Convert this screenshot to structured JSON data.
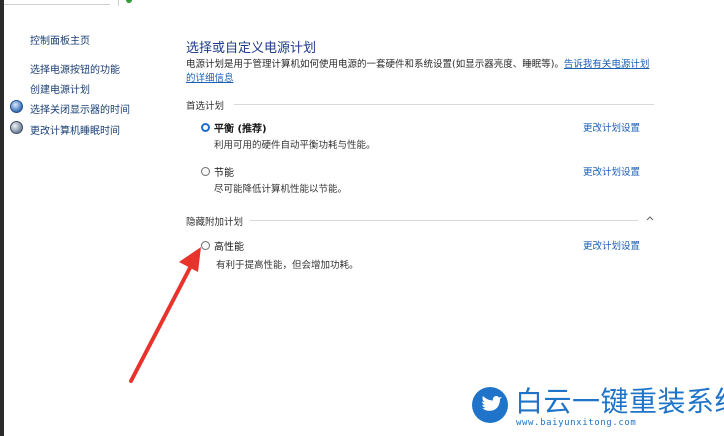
{
  "sidebar": {
    "items": [
      {
        "label": "控制面板主页",
        "icon": null
      },
      {
        "label": "选择电源按钮的功能",
        "icon": null
      },
      {
        "label": "创建电源计划",
        "icon": null
      },
      {
        "label": "选择关闭显示器的时间",
        "icon": "monitor-icon"
      },
      {
        "label": "更改计算机睡眠时间",
        "icon": "moon-icon"
      }
    ]
  },
  "main": {
    "title": "选择或自定义电源计划",
    "description": "电源计划是用于管理计算机如何使用电源的一套硬件和系统设置(如显示器亮度、睡眠等)。",
    "description_link": "告诉我有关电源计划的详细信息",
    "preferred_heading": "首选计划",
    "hidden_heading": "隐藏附加计划",
    "plans": [
      {
        "name": "平衡 (推荐)",
        "description": "利用可用的硬件自动平衡功耗与性能。",
        "selected": true,
        "change_label": "更改计划设置"
      },
      {
        "name": "节能",
        "description": "尽可能降低计算机性能以节能。",
        "selected": false,
        "change_label": "更改计划设置"
      },
      {
        "name": "高性能",
        "description": "有利于提高性能，但会增加功耗。",
        "selected": false,
        "change_label": "更改计划设置"
      }
    ]
  },
  "watermark": {
    "title": "白云一键重装系统",
    "url": "www.baiyunxitong.com"
  },
  "colors": {
    "link": "#1a5fb4",
    "title": "#1e3a8a",
    "annotation_arrow": "#e8322c",
    "watermark": "#1f74c9"
  }
}
